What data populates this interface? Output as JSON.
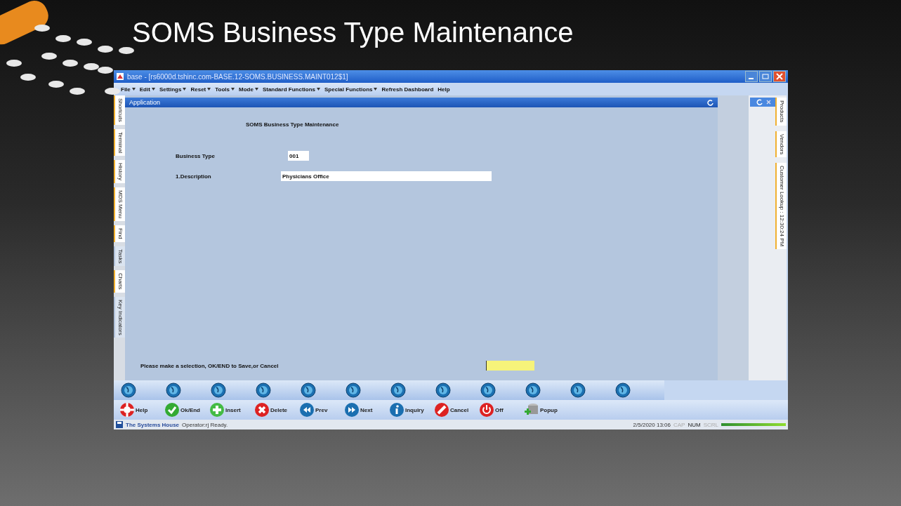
{
  "slide_title": "SOMS Business Type Maintenance",
  "window": {
    "title": "base - [rs6000d.tshinc.com-BASE.12-SOMS.BUSINESS.MAINT012$1]"
  },
  "menu": [
    "File",
    "Edit",
    "Settings",
    "Reset",
    "Tools",
    "Mode",
    "Standard Functions",
    "Special Functions",
    "Refresh Dashboard",
    "Help"
  ],
  "menu_dropdown": [
    true,
    true,
    true,
    true,
    true,
    true,
    true,
    true,
    false,
    false
  ],
  "left_tabs": [
    {
      "label": "Shortcuts",
      "accent": true
    },
    {
      "label": "Terminal",
      "accent": true
    },
    {
      "label": "History",
      "accent": true
    },
    {
      "label": "MDS Menu",
      "accent": true
    },
    {
      "label": "Find",
      "accent": true
    },
    {
      "label": "Tasks",
      "accent": false
    },
    {
      "label": "Charts",
      "accent": true
    },
    {
      "label": "Key Indicators",
      "accent": false
    }
  ],
  "panel": {
    "title": "Application"
  },
  "form": {
    "heading": "SOMS Business Type Maintenance",
    "fields": [
      {
        "label": "Business Type",
        "value": "001"
      },
      {
        "label": "1.Description",
        "value": "Physicians Office"
      }
    ],
    "prompt": "Please make a selection, OK/END to Save,or Cancel"
  },
  "right_tabs": [
    "Products",
    "Vendors",
    "Customer Lookup : 12:30:24 PM"
  ],
  "actions": [
    {
      "label": "Help",
      "kind": "help"
    },
    {
      "label": "Ok/End",
      "kind": "ok"
    },
    {
      "label": "Insert",
      "kind": "insert"
    },
    {
      "label": "Delete",
      "kind": "delete"
    },
    {
      "label": "Prev",
      "kind": "prev"
    },
    {
      "label": "Next",
      "kind": "next"
    },
    {
      "label": "Inquiry",
      "kind": "info"
    },
    {
      "label": "Cancel",
      "kind": "cancel"
    },
    {
      "label": "Off",
      "kind": "off"
    },
    {
      "label": "Popup",
      "kind": "popup"
    }
  ],
  "status_bar": {
    "company": "The Systems House",
    "message": "Operator:rj Ready.",
    "datetime": "2/5/2020 13:06",
    "progress": {
      "level": 1
    },
    "indicators": [
      {
        "label": "CAP",
        "on": false
      },
      {
        "label": "NUM",
        "on": true
      },
      {
        "label": "SCRL",
        "on": false
      }
    ]
  }
}
